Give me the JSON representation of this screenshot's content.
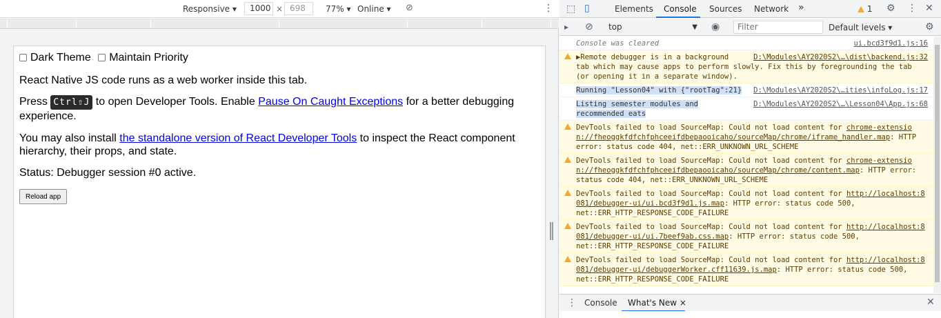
{
  "device_toolbar": {
    "device": "Responsive",
    "width": "1000",
    "height": "698",
    "zoom": "77%",
    "throttle": "Online"
  },
  "page": {
    "option_dark_theme": "Dark Theme",
    "option_maintain_priority": "Maintain Priority",
    "line1": "React Native JS code runs as a web worker inside this tab.",
    "press": "Press",
    "shortcut": "Ctrl⇧J",
    "press_after": "to open Developer Tools. Enable",
    "pause_link": "Pause On Caught Exceptions",
    "press_end": "for a better debugging",
    "press_end2": "experience.",
    "install_before": "You may also install",
    "install_link": "the standalone version of React Developer Tools",
    "install_after": "to inspect the React component",
    "install_after2": "hierarchy, their props, and state.",
    "status": "Status: Debugger session #0 active.",
    "reload_button": "Reload app"
  },
  "devtools": {
    "tabs": [
      "Elements",
      "Console",
      "Sources",
      "Network"
    ],
    "selected_tab": "Console",
    "more": "»",
    "warning_count": "1",
    "context": "top",
    "filter_placeholder": "Filter",
    "levels": "Default levels",
    "messages": [
      {
        "type": "clear",
        "text": "Console was cleared",
        "src": "ui.bcd3f9d1.js:16"
      },
      {
        "type": "warn",
        "text": "▶Remote debugger is in a background tab which may cause apps to perform slowly. Fix this by foregrounding the tab (or opening it in a separate window).",
        "src": "D:\\Modules\\AY2020S2\\…\\dist\\backend.js:32"
      },
      {
        "type": "log",
        "text": "Running \"Lesson04\" with {\"rootTag\":21}",
        "src": "D:\\Modules\\AY2020S2\\…ities\\infoLog.js:17"
      },
      {
        "type": "log",
        "text": "Listing semester modules and recommended eats",
        "src": "D:\\Modules\\AY2020S2\\…\\Lesson04\\App.js:68"
      },
      {
        "type": "warn",
        "text_before": "DevTools failed to load SourceMap: Could not load content for ",
        "link": "chrome-extension://fheoggkfdfchfphceeifdbepaooicaho/sourceMap/chrome/iframe_handler.map",
        "text_after": ": HTTP error: status code 404, net::ERR_UNKNOWN_URL_SCHEME"
      },
      {
        "type": "warn",
        "text_before": "DevTools failed to load SourceMap: Could not load content for ",
        "link": "chrome-extension://fheoggkfdfchfphceeifdbepaooicaho/sourceMap/chrome/content.map",
        "text_after": ": HTTP error: status code 404, net::ERR_UNKNOWN_URL_SCHEME"
      },
      {
        "type": "warn",
        "text_before": "DevTools failed to load SourceMap: Could not load content for ",
        "link": "http://localhost:8081/debugger-ui/ui.bcd3f9d1.js.map",
        "text_after": ": HTTP error: status code 500, net::ERR_HTTP_RESPONSE_CODE_FAILURE"
      },
      {
        "type": "warn",
        "text_before": "DevTools failed to load SourceMap: Could not load content for ",
        "link": "http://localhost:8081/debugger-ui/ui.7beef9ab.css.map",
        "text_after": ": HTTP error: status code 500, net::ERR_HTTP_RESPONSE_CODE_FAILURE"
      },
      {
        "type": "warn",
        "text_before": "DevTools failed to load SourceMap: Could not load content for ",
        "link": "http://localhost:8081/debugger-ui/debuggerWorker.cff11639.js.map",
        "text_after": ": HTTP error: status code 500, net::ERR_HTTP_RESPONSE_CODE_FAILURE"
      }
    ],
    "drawer_tabs": [
      "Console",
      "What's New"
    ],
    "drawer_close": "×"
  },
  "colors": {
    "accent": "#1a73e8",
    "warning": "#f2ab26",
    "link": "#0000ee"
  }
}
